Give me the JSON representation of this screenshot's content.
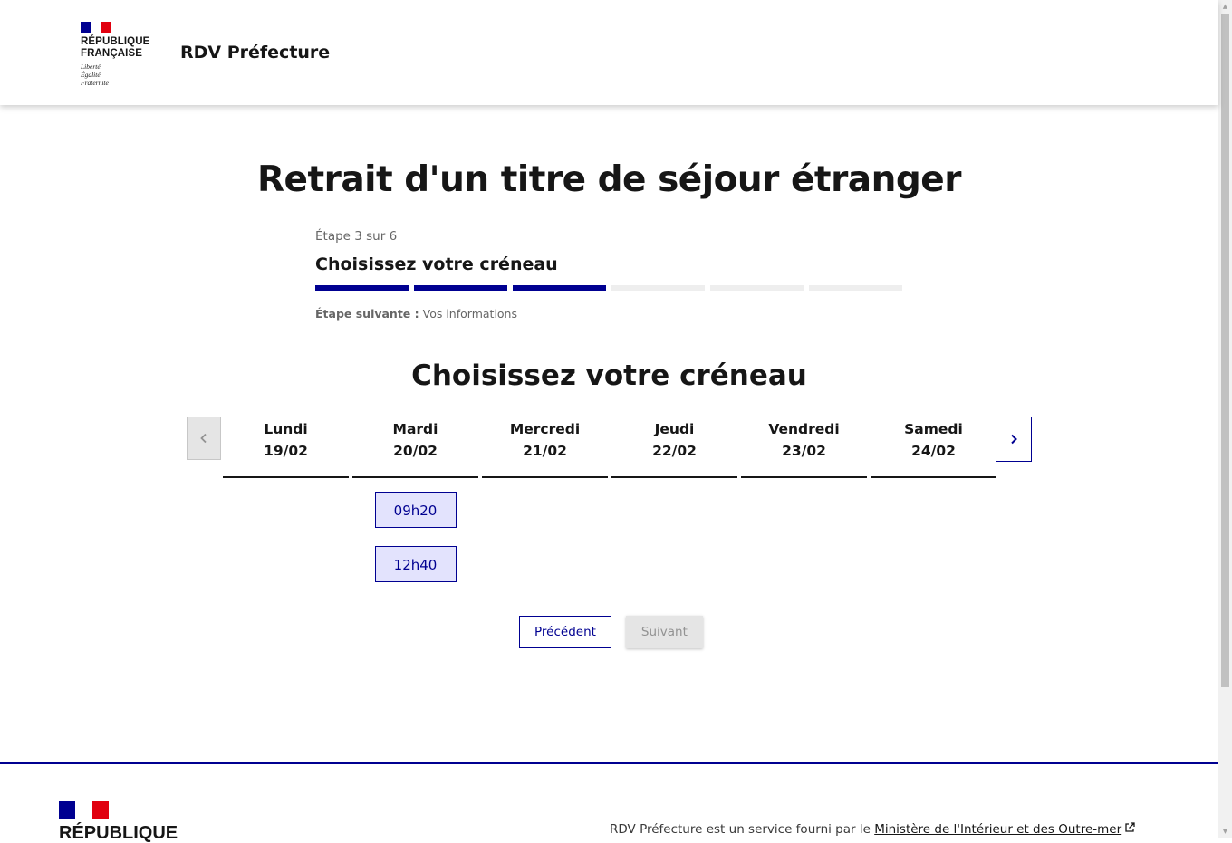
{
  "header": {
    "republic_name": "République Française",
    "motto": [
      "Liberté",
      "Égalité",
      "Fraternité"
    ],
    "site_title": "RDV Préfecture"
  },
  "main": {
    "page_title": "Retrait d'un titre de séjour étranger",
    "stepper": {
      "state": "Étape 3 sur 6",
      "title": "Choisissez votre créneau",
      "current_step": 3,
      "total_steps": 6,
      "next_label": "Étape suivante :",
      "next_value": "Vos informations"
    },
    "section_title": "Choisissez votre créneau",
    "days": [
      {
        "name": "Lundi",
        "date": "19/02",
        "slots": []
      },
      {
        "name": "Mardi",
        "date": "20/02",
        "slots": [
          "09h20",
          "12h40"
        ]
      },
      {
        "name": "Mercredi",
        "date": "21/02",
        "slots": []
      },
      {
        "name": "Jeudi",
        "date": "22/02",
        "slots": []
      },
      {
        "name": "Vendredi",
        "date": "23/02",
        "slots": []
      },
      {
        "name": "Samedi",
        "date": "24/02",
        "slots": []
      }
    ],
    "buttons": {
      "previous": "Précédent",
      "next": "Suivant"
    }
  },
  "footer": {
    "republic_name": "République",
    "description": "RDV Préfecture est un service fourni par le ",
    "ministry_link": "Ministère de l'Intérieur et des Outre-mer"
  },
  "icons": {
    "prev_week": "chevron-left-icon",
    "next_week": "chevron-right-icon",
    "external_link": "external-link-icon"
  },
  "colors": {
    "primary": "#000091",
    "slot_background": "#e3e3fd",
    "flag_red": "#e1000f",
    "disabled": "#e5e5e5"
  }
}
